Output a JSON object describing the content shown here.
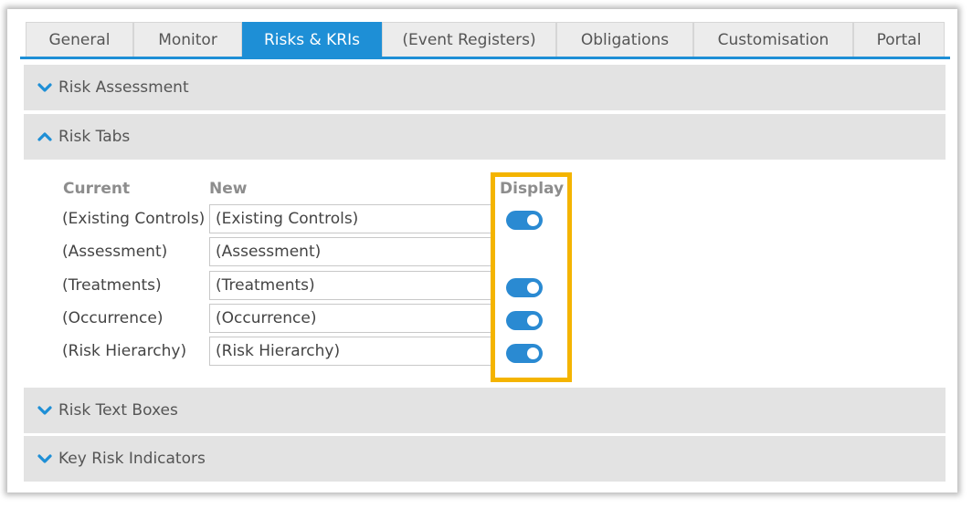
{
  "tabs": [
    {
      "label": "General"
    },
    {
      "label": "Monitor"
    },
    {
      "label": "Risks & KRIs",
      "active": true
    },
    {
      "label": "(Event Registers)"
    },
    {
      "label": "Obligations"
    },
    {
      "label": "Customisation"
    },
    {
      "label": "Portal"
    }
  ],
  "sections": {
    "risk_assessment": {
      "label": "Risk Assessment",
      "expanded": false
    },
    "risk_tabs": {
      "label": "Risk Tabs",
      "expanded": true
    },
    "risk_text_boxes": {
      "label": "Risk Text Boxes",
      "expanded": false
    },
    "key_risk_indicators": {
      "label": "Key Risk Indicators",
      "expanded": false
    }
  },
  "risk_tabs_table": {
    "headers": {
      "current": "Current",
      "new": "New",
      "display": "Display"
    },
    "rows": [
      {
        "current": "(Existing Controls)",
        "new": "(Existing Controls)",
        "display": true
      },
      {
        "current": "(Assessment)",
        "new": "(Assessment)",
        "display": false
      },
      {
        "current": "(Treatments)",
        "new": "(Treatments)",
        "display": true
      },
      {
        "current": "(Occurrence)",
        "new": "(Occurrence)",
        "display": true
      },
      {
        "current": "(Risk Hierarchy)",
        "new": "(Risk Hierarchy)",
        "display": true
      }
    ]
  },
  "colors": {
    "accent": "#1e8fd6",
    "toggle_on": "#2a8ad2",
    "highlight": "#f4b400",
    "section_bg": "#e3e3e3"
  },
  "icons": {
    "collapsed": "chevron-down-icon",
    "expanded": "chevron-up-icon"
  }
}
